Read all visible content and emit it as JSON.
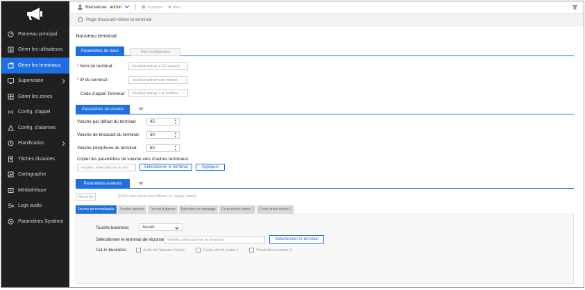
{
  "header": {
    "welcome": "Bienvenue",
    "user": "admin",
    "about": "A propos",
    "help": "Aide"
  },
  "breadcrumb": "Page d'accueil>Gérer le terminal",
  "sidebar": {
    "items": [
      {
        "label": "Panneau principal",
        "icon": "dashboard-icon"
      },
      {
        "label": "Gérer les utilisateurs",
        "icon": "users-icon"
      },
      {
        "label": "Gérer les terminaux",
        "icon": "terminal-icon",
        "active": true
      },
      {
        "label": "Supervision",
        "icon": "monitor-icon",
        "arrow": true
      },
      {
        "label": "Gérer les zones",
        "icon": "zones-icon"
      },
      {
        "label": "Config. d'appel",
        "icon": "call-icon"
      },
      {
        "label": "Config. d'alarmes",
        "icon": "alarm-icon"
      },
      {
        "label": "Planification",
        "icon": "clock-icon",
        "arrow": true
      },
      {
        "label": "Tâches distantes",
        "icon": "task-icon"
      },
      {
        "label": "Cartographie",
        "icon": "map-icon"
      },
      {
        "label": "Médiathèque",
        "icon": "media-icon"
      },
      {
        "label": "Logs audio",
        "icon": "logs-icon"
      },
      {
        "label": "Paramètres Système",
        "icon": "settings-icon"
      }
    ]
  },
  "main": {
    "title": "Nouveau terminal",
    "tabs": {
      "basic": "Paramètres de base",
      "auto": "Auto configuration"
    },
    "basic": {
      "name_label": "Nom du terminal :",
      "name_placeholder": "Veuillez entrer 4-20 caracti",
      "ip_label": "IP du terminal :",
      "ip_placeholder": "Veuillez entrer une donné",
      "code_label": "Code d'appel Terminal:",
      "code_placeholder": "Veuillez entrer 1-4 chiffres"
    },
    "volume": {
      "header": "Paramètres de volume",
      "default_label": "Volume par défaut du terminal:",
      "default_value": "45",
      "broadcast_label": "Volume de broacast du terminal:",
      "broadcast_value": "60",
      "intercom_label": "Volume interphone du terminal:",
      "intercom_value": "60",
      "copy_label": "Copier les paramètres de volume vers d'autres terminaux:",
      "copy_placeholder": "Veuillez sélectionner le teri",
      "select_button": "Sélectionner le terminal",
      "apply_button": "Appliquer"
    },
    "advanced": {
      "header": "Paramètres avancés",
      "reset_button": "Recouvrir",
      "hint": "(Définir une touche pour diffuser un réglage rapide)",
      "subtabs": [
        "Touche personnalisable",
        "Touche étendue",
        "Touche d'alarme",
        "Détection de sabotage",
        "Court-circuit entrée 1",
        "Court-circuit entrée 2"
      ],
      "business_label": "Touche business:",
      "business_value": "Aucun",
      "response_label": "Sélectionner le terminal de réponse :",
      "response_placeholder": "Veuillez sélectionner le terminal",
      "response_button": "Sélectionner le terminal",
      "cutin_label": "Cut-in business:",
      "cutin_options": [
        "Arrêt de l'alarme forcée",
        "Court-circuit sortie 1",
        "Court-circuit sortie 2"
      ]
    }
  },
  "colors": {
    "accent": "#1e6fe0",
    "sidebar_bg": "#202020"
  }
}
